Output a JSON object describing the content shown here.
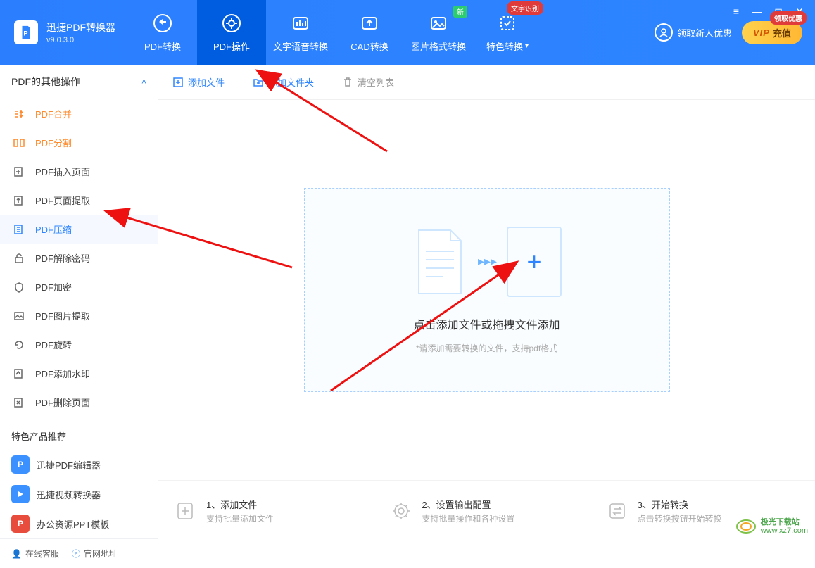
{
  "app": {
    "title": "迅捷PDF转换器",
    "version": "v9.0.3.0"
  },
  "nav": {
    "tabs": [
      {
        "label": "PDF转换"
      },
      {
        "label": "PDF操作"
      },
      {
        "label": "文字语音转换"
      },
      {
        "label": "CAD转换"
      },
      {
        "label": "图片格式转换",
        "badge_new": "新"
      },
      {
        "label": "特色转换",
        "badge_text": "文字识别"
      }
    ]
  },
  "header_right": {
    "new_user": "领取新人优惠",
    "vip_label": "充值",
    "vip_prefix": "VIP",
    "vip_badge": "领取优惠"
  },
  "sidebar": {
    "header": "PDF的其他操作",
    "items": [
      {
        "label": "PDF合并"
      },
      {
        "label": "PDF分割"
      },
      {
        "label": "PDF插入页面"
      },
      {
        "label": "PDF页面提取"
      },
      {
        "label": "PDF压缩"
      },
      {
        "label": "PDF解除密码"
      },
      {
        "label": "PDF加密"
      },
      {
        "label": "PDF图片提取"
      },
      {
        "label": "PDF旋转"
      },
      {
        "label": "PDF添加水印"
      },
      {
        "label": "PDF删除页面"
      }
    ],
    "recommend_title": "特色产品推荐",
    "recommend": [
      {
        "label": "迅捷PDF编辑器"
      },
      {
        "label": "迅捷视频转换器"
      },
      {
        "label": "办公资源PPT模板"
      }
    ],
    "footer": {
      "cs": "在线客服",
      "site": "官网地址"
    }
  },
  "toolbar": {
    "add_file": "添加文件",
    "add_folder": "添加文件夹",
    "clear_list": "清空列表"
  },
  "dropzone": {
    "title": "点击添加文件或拖拽文件添加",
    "sub": "*请添加需要转换的文件，支持pdf格式"
  },
  "steps": [
    {
      "title": "1、添加文件",
      "sub": "支持批量添加文件"
    },
    {
      "title": "2、设置输出配置",
      "sub": "支持批量操作和各种设置"
    },
    {
      "title": "3、开始转换",
      "sub": "点击转换按钮开始转换"
    }
  ],
  "watermark": {
    "cn": "极光下载站",
    "url": "www.xz7.com"
  }
}
